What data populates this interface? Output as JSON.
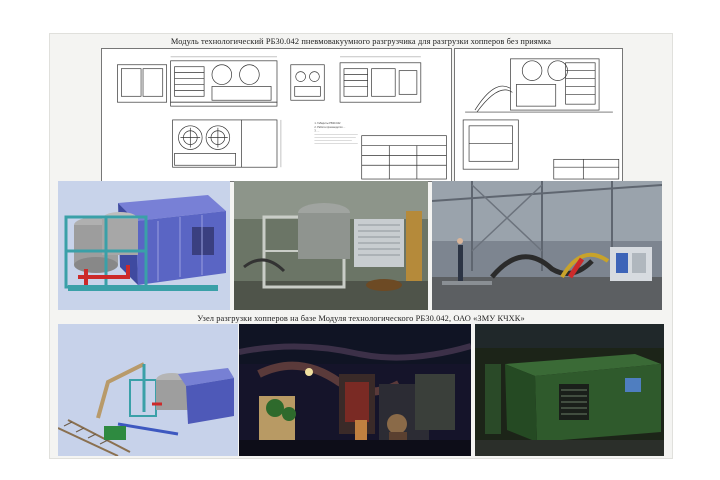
{
  "captions": {
    "top": "Модуль технологический РБ30.042 пневмовакуумного разгрузчика для разгрузки хопперов без приямка",
    "middle": "Узел разгрузки хопперов на базе Модуля технологического РБ30.042, ОАО «ЗМУ КЧХК»"
  },
  "drawing_left": {
    "notes": [
      "1. Габариты РБ30.042",
      "2. Работа производится ...",
      "3. ..."
    ]
  },
  "colors": {
    "cad_background": "#c8d3ea",
    "module_blue": "#5a65c4",
    "frame_teal": "#3aa0a8",
    "pipe_red": "#cc2a2a",
    "module_green": "#2f5a2c",
    "night_sky": "#15142a"
  },
  "images": [
    {
      "id": "cad-render-module",
      "kind": "3d-render"
    },
    {
      "id": "photo-workshop-frame",
      "kind": "photo"
    },
    {
      "id": "photo-hall-testing",
      "kind": "photo"
    },
    {
      "id": "cad-render-hopper-unloading",
      "kind": "3d-render"
    },
    {
      "id": "photo-night-site",
      "kind": "photo"
    },
    {
      "id": "photo-green-module",
      "kind": "photo"
    }
  ]
}
